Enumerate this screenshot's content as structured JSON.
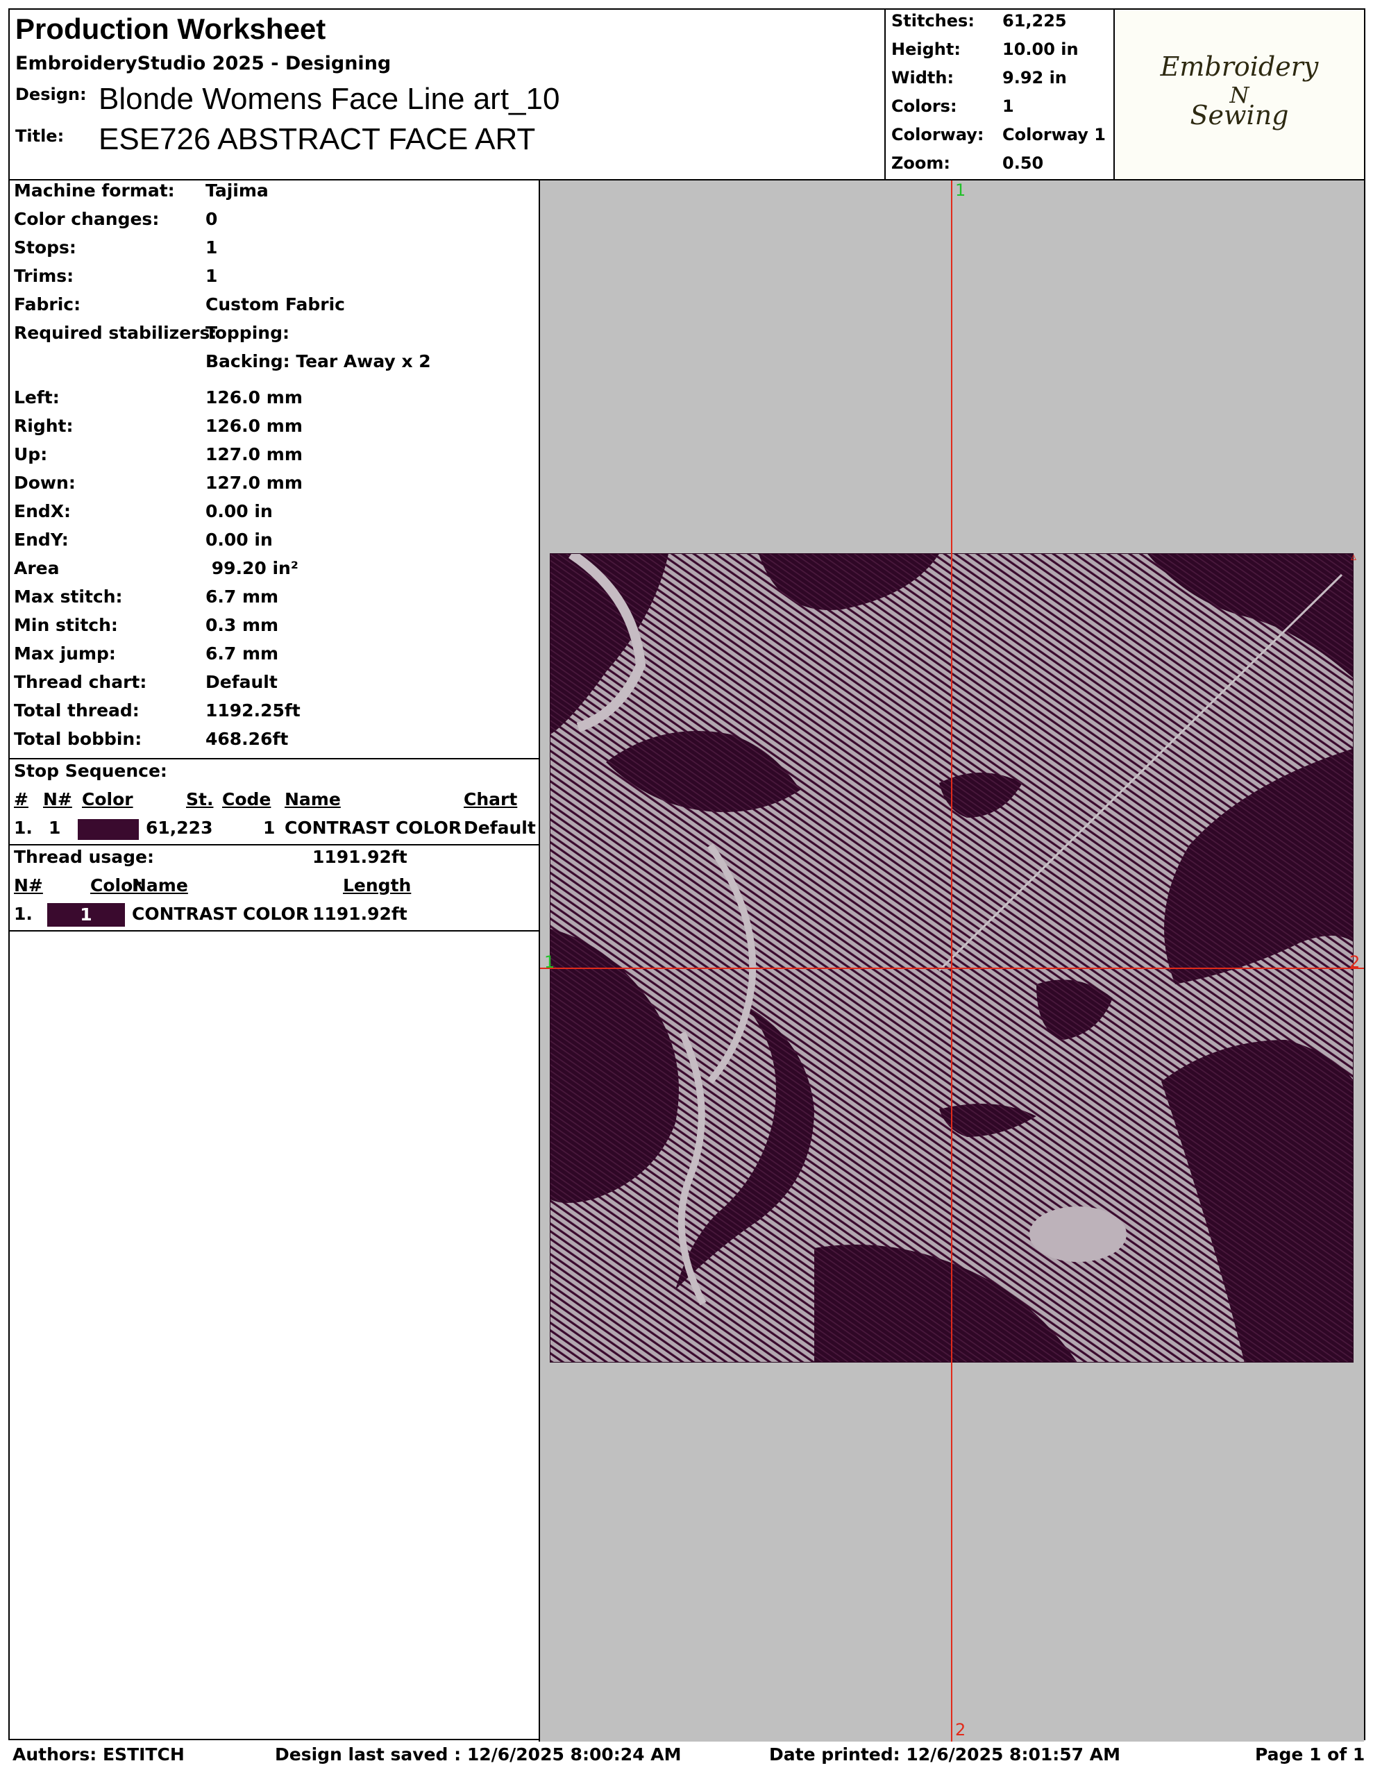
{
  "header": {
    "title": "Production Worksheet",
    "app": "EmbroideryStudio 2025 - Designing",
    "design_label": "Design:",
    "design_value": "Blonde Womens Face Line art_10",
    "title_label": "Title:",
    "title_value": "ESE726 ABSTRACT FACE ART"
  },
  "stats": [
    {
      "label": "Stitches:",
      "value": "61,225"
    },
    {
      "label": "Height:",
      "value": "10.00 in"
    },
    {
      "label": "Width:",
      "value": "9.92 in"
    },
    {
      "label": "Colors:",
      "value": "1"
    },
    {
      "label": "Colorway:",
      "value": "Colorway 1"
    },
    {
      "label": "Zoom:",
      "value": "0.50"
    }
  ],
  "logo": {
    "line1": "Embroidery",
    "line2": "N",
    "line3": "Sewing"
  },
  "info": [
    {
      "label": "Machine format:",
      "value": "Tajima"
    },
    {
      "label": "Color changes:",
      "value": "0"
    },
    {
      "label": "Stops:",
      "value": "1"
    },
    {
      "label": "Trims:",
      "value": "1"
    },
    {
      "label": "Fabric:",
      "value": "Custom Fabric"
    },
    {
      "label": "Required stabilizers:",
      "value": "Topping:"
    },
    {
      "label": "",
      "value": "Backing: Tear Away x 2"
    }
  ],
  "dims": [
    {
      "label": "Left:",
      "value": "126.0 mm"
    },
    {
      "label": "Right:",
      "value": "126.0 mm"
    },
    {
      "label": "Up:",
      "value": "127.0 mm"
    },
    {
      "label": "Down:",
      "value": "127.0 mm"
    },
    {
      "label": "EndX:",
      "value": "0.00 in"
    },
    {
      "label": "EndY:",
      "value": "0.00 in"
    },
    {
      "label": "Area",
      "value": " 99.20 in²"
    },
    {
      "label": "Max stitch:",
      "value": "6.7 mm"
    },
    {
      "label": "Min stitch:",
      "value": "0.3 mm"
    },
    {
      "label": "Max jump:",
      "value": "6.7 mm"
    },
    {
      "label": "Thread chart:",
      "value": "Default"
    },
    {
      "label": "Total thread:",
      "value": "1192.25ft"
    },
    {
      "label": "Total bobbin:",
      "value": "468.26ft"
    }
  ],
  "stop_sequence": {
    "heading": "Stop Sequence:",
    "headers": {
      "idx": "#",
      "n": "N#",
      "color": "Color",
      "st": "St.",
      "code": "Code",
      "name": "Name",
      "chart": "Chart"
    },
    "row": {
      "idx": "1.",
      "n": "1",
      "stitches": "61,223",
      "code": "1",
      "name": "CONTRAST COLOR",
      "chart": "Default"
    }
  },
  "thread_usage": {
    "heading": "Thread usage:",
    "total": "1191.92ft",
    "headers": {
      "n": "N#",
      "color": "Color",
      "name": "Name",
      "length": "Length"
    },
    "row": {
      "idx": "1.",
      "swatch_num": "1",
      "name": "CONTRAST COLOR",
      "length": "1191.92ft"
    }
  },
  "thread_color": "#3a0a2e",
  "preview": {
    "marker_top": "1",
    "marker_bottom": "2",
    "marker_left": "1",
    "marker_right": "2"
  },
  "footer": {
    "authors": "Authors: ESTITCH",
    "saved": "Design last saved : 12/6/2025 8:00:24 AM",
    "printed": "Date printed: 12/6/2025 8:01:57 AM",
    "page": "Page 1 of 1"
  }
}
